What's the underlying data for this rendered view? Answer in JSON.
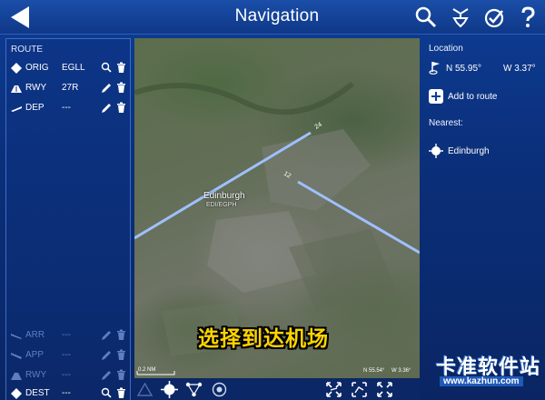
{
  "header": {
    "title": "Navigation",
    "back_icon": "back-arrow-icon",
    "actions": [
      "search-icon",
      "routing-icon",
      "check-badge-icon",
      "help-icon"
    ]
  },
  "route": {
    "heading": "ROUTE",
    "rows": [
      {
        "label": "ORIG",
        "value": "EGLL",
        "icon": "origin-diamond-icon",
        "action1": "search-icon",
        "action2": "trash-icon",
        "active": true
      },
      {
        "label": "RWY",
        "value": "27R",
        "icon": "runway-icon",
        "action1": "pencil-icon",
        "action2": "trash-icon",
        "active": true
      },
      {
        "label": "DEP",
        "value": "---",
        "icon": "departure-icon",
        "action1": "pencil-icon",
        "action2": "trash-icon",
        "active": true
      },
      {
        "label": "ARR",
        "value": "---",
        "icon": "arrival-icon",
        "action1": "pencil-icon",
        "action2": "trash-icon",
        "active": false
      },
      {
        "label": "APP",
        "value": "---",
        "icon": "approach-icon",
        "action1": "pencil-icon",
        "action2": "trash-icon",
        "active": false
      },
      {
        "label": "RWY",
        "value": "---",
        "icon": "runway-icon",
        "action1": "pencil-icon",
        "action2": "trash-icon",
        "active": false
      },
      {
        "label": "DEST",
        "value": "---",
        "icon": "destination-diamond-icon",
        "action1": "search-icon",
        "action2": "trash-icon",
        "active": true
      }
    ]
  },
  "map": {
    "airport_name": "Edinburgh",
    "airport_code": "EDI/EGPH",
    "runway_label_a": "24",
    "runway_label_b": "12",
    "scale": "0.2 NM",
    "coord_n": "N 55.54°",
    "coord_w": "W 3.36°",
    "caption": "选择到达机场"
  },
  "toolbar": {
    "icons": [
      "triangle-icon",
      "airport-target-icon",
      "waypoint-network-icon",
      "vor-icon",
      "zoom-fit-icon",
      "route-fit-icon",
      "expand-icon"
    ]
  },
  "info": {
    "location_heading": "Location",
    "lat": "N 55.95°",
    "lon": "W 3.37°",
    "add_to_route": "Add to route",
    "nearest_heading": "Nearest:",
    "nearest_item": "Edinburgh"
  },
  "watermark": {
    "main": "卡准软件站",
    "sub": "www.kazhun.com"
  },
  "colors": {
    "background": "#0a2a6e",
    "accent": "#3b6cc8",
    "runway": "#8ab4ff",
    "caption": "#ffd400"
  }
}
